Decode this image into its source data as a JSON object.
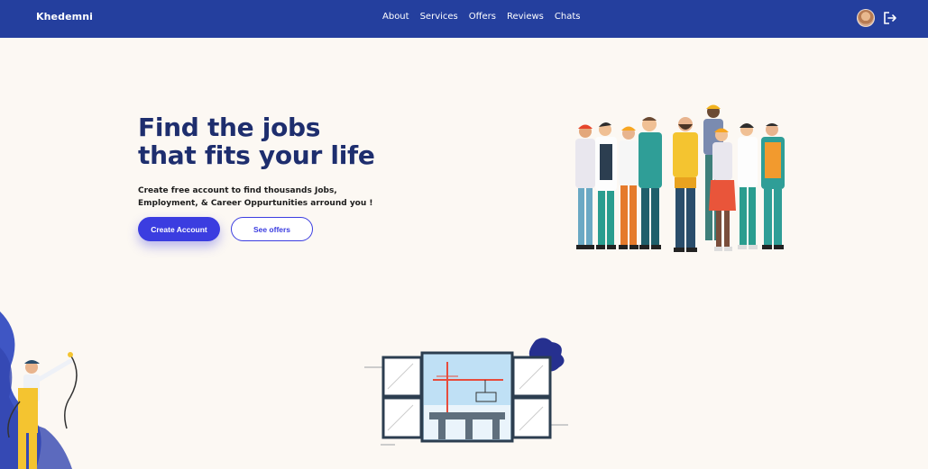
{
  "navbar": {
    "brand": "Khedemni",
    "links": [
      "About",
      "Services",
      "Offers",
      "Reviews",
      "Chats"
    ],
    "avatar_icon": "user-avatar",
    "logout_icon": "logout-icon",
    "background": "#243f9e"
  },
  "hero": {
    "title_line1": "Find the jobs",
    "title_line2": "that fits your life",
    "subtitle_line1": "Create free account to find thousands Jobs,",
    "subtitle_line2": "Employment, & Career Oppurtunities arround you !",
    "primary_button": "Create Account",
    "secondary_button": "See offers",
    "accent": "#3b3de0",
    "title_color": "#1e2e6e"
  },
  "illustrations": {
    "workers": "workers-group-illustration",
    "worker_left": "electrician-worker-illustration",
    "window": "construction-window-illustration"
  }
}
